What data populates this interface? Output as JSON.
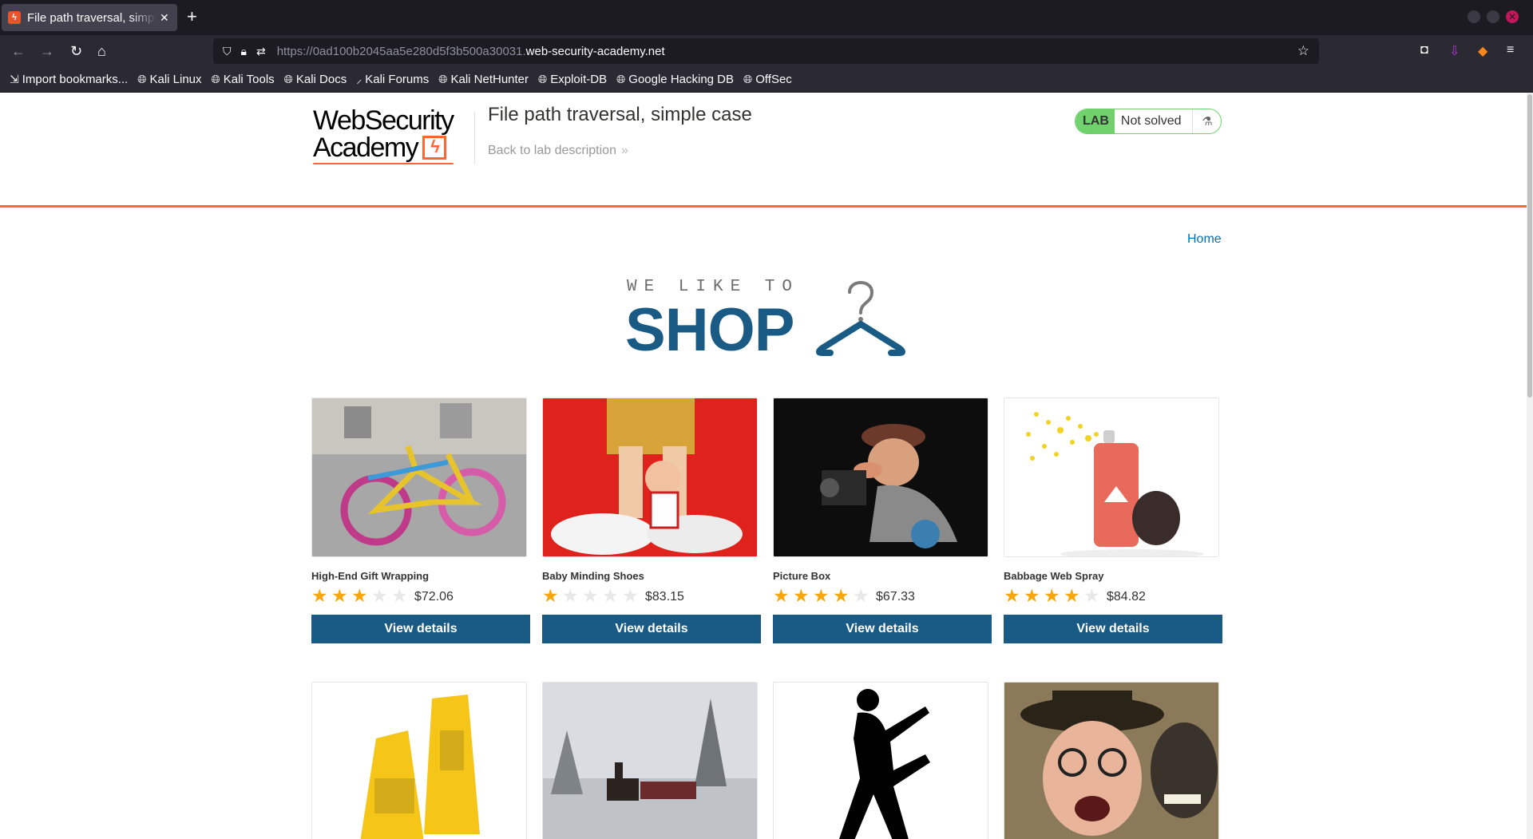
{
  "browser": {
    "tab_title": "File path traversal, simple case",
    "tab_close": "✕",
    "new_tab": "+",
    "url_prefix": "https://0ad100b2045aa5e280d5f3b500a30031.",
    "url_domain": "web-security-academy.net",
    "bookmarks": [
      {
        "label": "Import bookmarks...",
        "icon": "import-icon"
      },
      {
        "label": "Kali Linux",
        "icon": "globe-icon"
      },
      {
        "label": "Kali Tools",
        "icon": "globe-icon"
      },
      {
        "label": "Kali Docs",
        "icon": "globe-icon"
      },
      {
        "label": "Kali Forums",
        "icon": "kali-dragon-icon"
      },
      {
        "label": "Kali NetHunter",
        "icon": "globe-icon"
      },
      {
        "label": "Exploit-DB",
        "icon": "globe-icon"
      },
      {
        "label": "Google Hacking DB",
        "icon": "globe-icon"
      },
      {
        "label": "OffSec",
        "icon": "globe-icon"
      }
    ]
  },
  "header": {
    "logo_line1": "WebSecurity",
    "logo_line2": "Academy",
    "lab_title": "File path traversal, simple case",
    "back_link": "Back to lab description",
    "lab_badge": "LAB",
    "lab_status": "Not solved",
    "accent_color": "#ff6633",
    "status_color": "#70d16d"
  },
  "nav": {
    "home": "Home"
  },
  "banner": {
    "small_text": "WE LIKE TO",
    "big_text": "SHOP"
  },
  "products": [
    {
      "name": "High-End Gift Wrapping",
      "rating": 3,
      "price": "$72.06",
      "button": "View details",
      "image": "knitted-bicycle"
    },
    {
      "name": "Baby Minding Shoes",
      "rating": 1,
      "price": "$83.15",
      "button": "View details",
      "image": "giant-shoes-doll"
    },
    {
      "name": "Picture Box",
      "rating": 4,
      "price": "$67.33",
      "button": "View details",
      "image": "photographer-figurine"
    },
    {
      "name": "Babbage Web Spray",
      "rating": 4,
      "price": "$84.82",
      "button": "View details",
      "image": "spray-can"
    },
    {
      "name": "",
      "image": "caution-signs"
    },
    {
      "name": "",
      "image": "steam-train-snow"
    },
    {
      "name": "",
      "image": "dancing-silhouette"
    },
    {
      "name": "",
      "image": "old-man-monkey"
    }
  ],
  "colors": {
    "button": "#1a5b86",
    "star": "#f7a70b",
    "link": "#0071bc"
  }
}
